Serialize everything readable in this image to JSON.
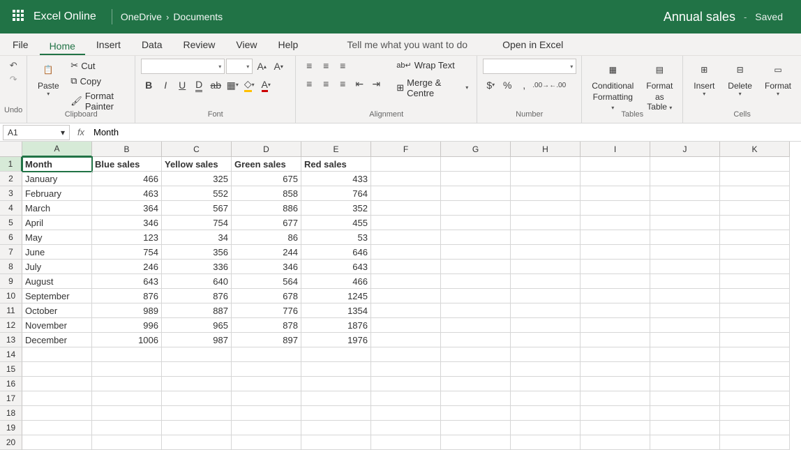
{
  "header": {
    "app_name": "Excel Online",
    "breadcrumb": [
      "OneDrive",
      "Documents"
    ],
    "doc_name": "Annual sales",
    "status": "Saved"
  },
  "tabs": {
    "file": "File",
    "home": "Home",
    "insert": "Insert",
    "data": "Data",
    "review": "Review",
    "view": "View",
    "help": "Help",
    "tell_me": "Tell me what you want to do",
    "open_in_excel": "Open in Excel"
  },
  "ribbon": {
    "undo": "Undo",
    "clipboard": {
      "paste": "Paste",
      "cut": "Cut",
      "copy": "Copy",
      "format_painter": "Format Painter",
      "label": "Clipboard"
    },
    "font": {
      "label": "Font"
    },
    "alignment": {
      "wrap_text": "Wrap Text",
      "merge_centre": "Merge & Centre",
      "label": "Alignment"
    },
    "number": {
      "label": "Number"
    },
    "tables": {
      "conditional": "Conditional",
      "formatting": "Formatting",
      "format": "Format",
      "as_table": "as Table",
      "label": "Tables"
    },
    "cells": {
      "insert": "Insert",
      "delete": "Delete",
      "format": "Format",
      "label": "Cells"
    }
  },
  "formula_bar": {
    "name_box": "A1",
    "formula": "Month"
  },
  "grid": {
    "columns": [
      "A",
      "B",
      "C",
      "D",
      "E",
      "F",
      "G",
      "H",
      "I",
      "J",
      "K"
    ],
    "selected_cell": "A1",
    "headers_row": [
      "Month",
      "Blue sales",
      "Yellow sales",
      "Green sales",
      "Red sales",
      "",
      "",
      "",
      "",
      "",
      ""
    ],
    "data_rows": [
      [
        "January",
        "466",
        "325",
        "675",
        "433",
        "",
        "",
        "",
        "",
        "",
        ""
      ],
      [
        "February",
        "463",
        "552",
        "858",
        "764",
        "",
        "",
        "",
        "",
        "",
        ""
      ],
      [
        "March",
        "364",
        "567",
        "886",
        "352",
        "",
        "",
        "",
        "",
        "",
        ""
      ],
      [
        "April",
        "346",
        "754",
        "677",
        "455",
        "",
        "",
        "",
        "",
        "",
        ""
      ],
      [
        "May",
        "123",
        "34",
        "86",
        "53",
        "",
        "",
        "",
        "",
        "",
        ""
      ],
      [
        "June",
        "754",
        "356",
        "244",
        "646",
        "",
        "",
        "",
        "",
        "",
        ""
      ],
      [
        "July",
        "246",
        "336",
        "346",
        "643",
        "",
        "",
        "",
        "",
        "",
        ""
      ],
      [
        "August",
        "643",
        "640",
        "564",
        "466",
        "",
        "",
        "",
        "",
        "",
        ""
      ],
      [
        "September",
        "876",
        "876",
        "678",
        "1245",
        "",
        "",
        "",
        "",
        "",
        ""
      ],
      [
        "October",
        "989",
        "887",
        "776",
        "1354",
        "",
        "",
        "",
        "",
        "",
        ""
      ],
      [
        "November",
        "996",
        "965",
        "878",
        "1876",
        "",
        "",
        "",
        "",
        "",
        ""
      ],
      [
        "December",
        "1006",
        "987",
        "897",
        "1976",
        "",
        "",
        "",
        "",
        "",
        ""
      ]
    ],
    "empty_rows": 7,
    "first_row_number": 1
  }
}
